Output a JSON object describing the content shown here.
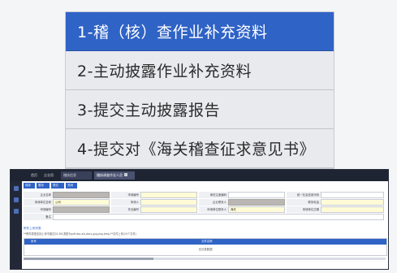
{
  "menu": {
    "items": [
      {
        "label": "1-稽（核）查作业补充资料",
        "active": true
      },
      {
        "label": "2-主动披露作业补充资料",
        "active": false
      },
      {
        "label": "3-提交主动披露报告",
        "active": false
      },
      {
        "label": "4-提交对《海关稽查征求意见书》",
        "active": false
      }
    ],
    "active_color": "#2f63c6"
  },
  "screen": {
    "tabs": [
      "首页",
      "企业用户",
      "稽核信息",
      "稽核调查作业人员"
    ],
    "toolbar": [
      "保存",
      "暂存",
      "提交",
      "关闭"
    ],
    "form": {
      "row1": {
        "l1": "企业名称",
        "l2": "申请编号",
        "l3": "海关注册编码",
        "l4": "统一社会信用代码"
      },
      "row2": {
        "l1": "申请单位名称",
        "f1": "公司",
        "l2": "申请人",
        "l3": "企业联系人",
        "l4": "联系电话"
      },
      "row3": {
        "l1": "申请编号",
        "l2": "作业编号",
        "l3": "申请单位联系人",
        "f3": "海关",
        "l4": "申请单位日期"
      },
      "row4": {
        "l1": "备注"
      }
    },
    "section_title": "附件上传列表",
    "note": "**附件类型支持上传不超过20.5M,类型为pdf,doc,xls,docx,jpg,png,bmp,**文件上传(15个文件)",
    "table": {
      "headers": [
        "序号",
        "文件名称"
      ],
      "empty_text": "无记录数据"
    }
  }
}
